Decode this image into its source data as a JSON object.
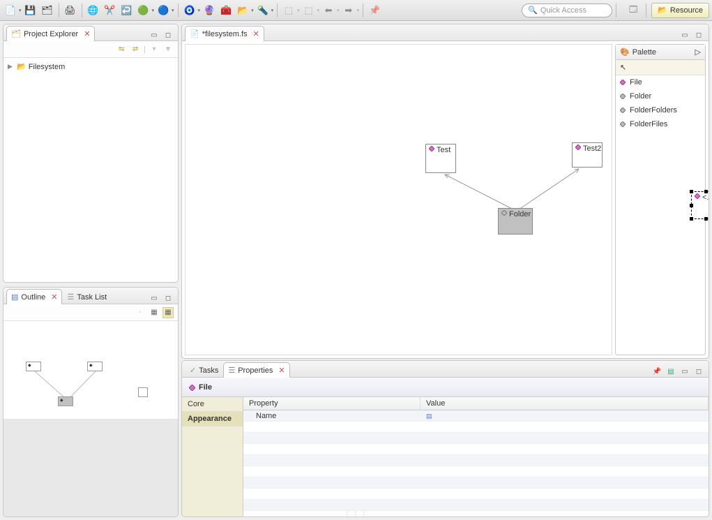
{
  "toolbar": {
    "quick_access_placeholder": "Quick Access"
  },
  "perspective": {
    "resource_label": "Resource"
  },
  "project_explorer": {
    "title": "Project Explorer",
    "root": "Filesystem"
  },
  "editor": {
    "tab_title": "*filesystem.fs",
    "nodes": {
      "test": "Test",
      "test2": "Test2",
      "folder": "Folder",
      "new_placeholder": "<...>"
    }
  },
  "palette": {
    "title": "Palette",
    "items": [
      "File",
      "Folder",
      "FolderFolders",
      "FolderFiles"
    ]
  },
  "outline": {
    "title": "Outline",
    "tasklist_title": "Task List"
  },
  "bottom": {
    "tasks_tab": "Tasks",
    "properties_tab": "Properties",
    "header_title": "File",
    "categories": [
      "Core",
      "Appearance"
    ],
    "columns": {
      "property": "Property",
      "value": "Value"
    },
    "rows": [
      {
        "property": "Name",
        "value": ""
      }
    ]
  }
}
